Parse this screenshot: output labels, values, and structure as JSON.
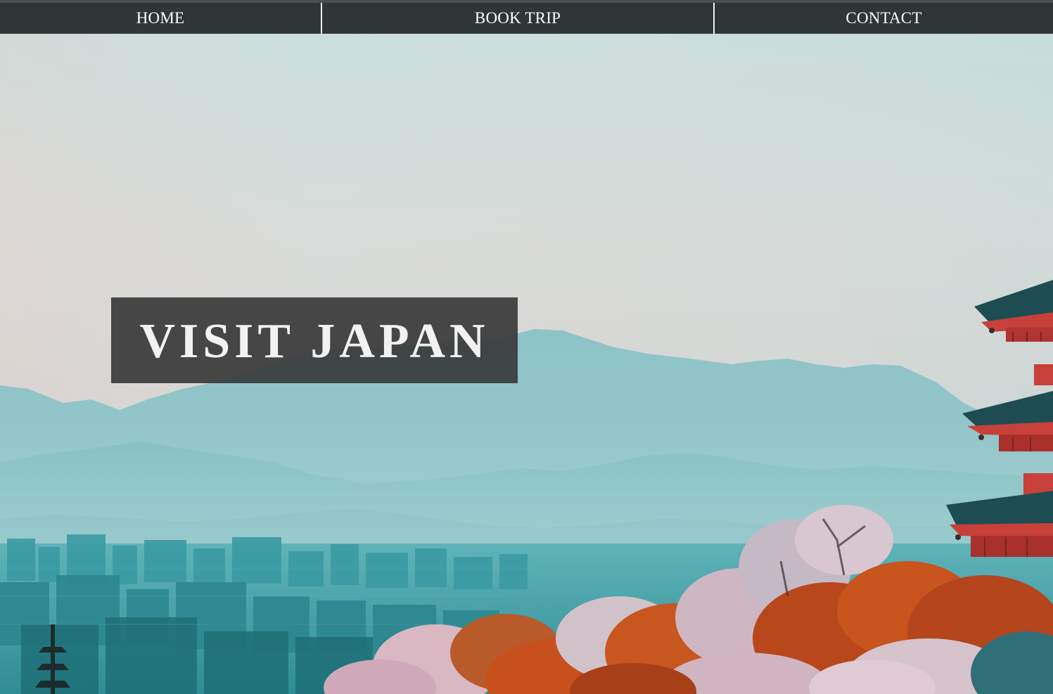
{
  "nav": {
    "items": [
      {
        "label": "HOME"
      },
      {
        "label": "BOOK TRIP"
      },
      {
        "label": "CONTACT"
      }
    ]
  },
  "hero": {
    "title": "VISIT JAPAN",
    "image_subject": "Mountain landscape with city, cherry blossom trees and a red pagoda"
  },
  "colors": {
    "nav_background": "#2f3638",
    "nav_text": "#ffffff",
    "title_box": "#3a3a3a",
    "sky_top": "#c7dedd",
    "mountains": "#8fc4c8",
    "pagoda_red": "#c8403a",
    "foliage_orange": "#c8561f"
  }
}
